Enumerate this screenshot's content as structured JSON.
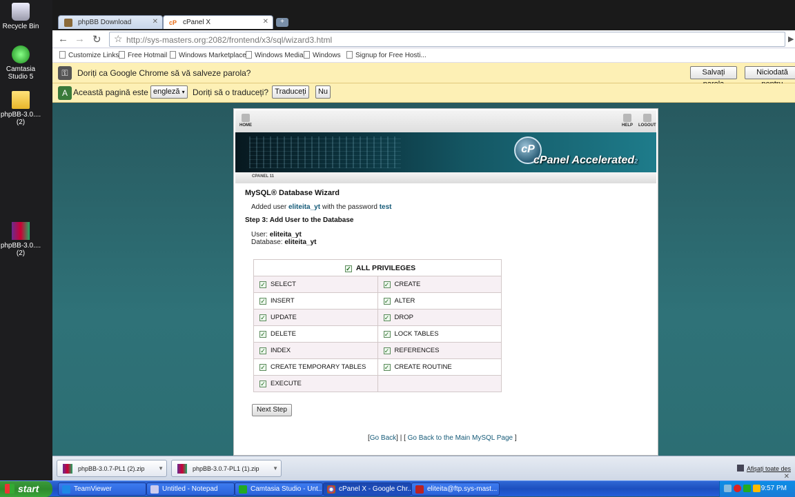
{
  "desktop": {
    "icons": [
      {
        "label": "Recycle Bin"
      },
      {
        "label": "Camtasia Studio 5"
      },
      {
        "label": "phpBB-3.0.... (2)"
      },
      {
        "label": "phpBB-3.0.... (2)"
      }
    ]
  },
  "browser": {
    "tabs": [
      {
        "label": "phpBB Download"
      },
      {
        "label": "cPanel X"
      }
    ],
    "url": "http://sys-masters.org:2082/frontend/x3/sql/wizard3.html",
    "bookmarks": [
      "Customize Links",
      "Free Hotmail",
      "Windows Marketplace",
      "Windows Media",
      "Windows",
      "Signup for Free Hosti..."
    ],
    "password_bar": {
      "text": "Doriți ca Google Chrome să vă salveze parola?",
      "save_label": "Salvați parola",
      "never_label": "Niciodată pentru"
    },
    "translate_bar": {
      "prefix": "Această pagină este în",
      "language": "engleză",
      "question": "Doriți să o traduceți?",
      "translate_label": "Traduceți",
      "no_label": "Nu"
    }
  },
  "cpanel": {
    "nav": {
      "home": "HOME",
      "help": "HELP",
      "logout": "LOGOUT"
    },
    "logo_letters": "cP",
    "brand": "cPanel Accelerated",
    "brand_version": "2",
    "subbar": "CPANEL 11",
    "title": "MySQL® Database Wizard",
    "added_prefix": "Added user",
    "added_user": "eliteita_yt",
    "added_middle": "with the password",
    "added_password": "test",
    "step_title": "Step 3: Add User to the Database",
    "user_label": "User:",
    "user_value": "eliteita_yt",
    "db_label": "Database:",
    "db_value": "eliteita_yt",
    "all_privileges": "ALL PRIVILEGES",
    "privileges": [
      [
        "SELECT",
        "CREATE"
      ],
      [
        "INSERT",
        "ALTER"
      ],
      [
        "UPDATE",
        "DROP"
      ],
      [
        "DELETE",
        "LOCK TABLES"
      ],
      [
        "INDEX",
        "REFERENCES"
      ],
      [
        "CREATE TEMPORARY TABLES",
        "CREATE ROUTINE"
      ],
      [
        "EXECUTE",
        ""
      ]
    ],
    "next_label": "Next Step",
    "back_link": "Go Back",
    "main_link": "Go Back to the Main MySQL Page"
  },
  "downloads": {
    "items": [
      "phpBB-3.0.7-PL1 (2).zip",
      "phpBB-3.0.7-PL1 (1).zip"
    ],
    "show_all": "Afișați toate des"
  },
  "taskbar": {
    "start": "start",
    "tasks": [
      "TeamViewer",
      "Untitled - Notepad",
      "Camtasia Studio - Unt...",
      "cPanel X - Google Chr...",
      "eliteita@ftp.sys-mast..."
    ],
    "time": "9:57 PM"
  },
  "colors": {
    "accent": "#155a78",
    "infobar": "#fdf0b5",
    "taskbar": "#245edb"
  }
}
